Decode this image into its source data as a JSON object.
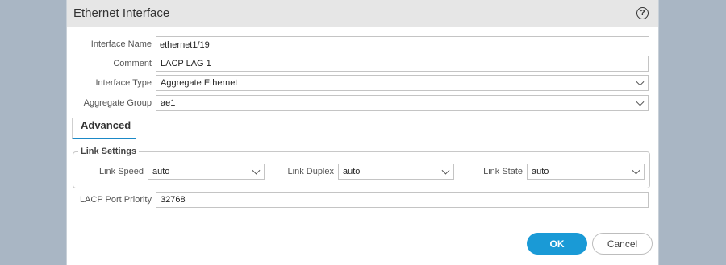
{
  "dialog": {
    "title": "Ethernet Interface",
    "help": "?"
  },
  "form": {
    "interface_name": {
      "label": "Interface Name",
      "value": "ethernet1/19"
    },
    "comment": {
      "label": "Comment",
      "value": "LACP LAG 1"
    },
    "interface_type": {
      "label": "Interface Type",
      "value": "Aggregate Ethernet"
    },
    "aggregate_group": {
      "label": "Aggregate Group",
      "value": "ae1"
    }
  },
  "tabs": [
    {
      "label": "Advanced"
    }
  ],
  "link_settings": {
    "legend": "Link Settings",
    "speed": {
      "label": "Link Speed",
      "value": "auto"
    },
    "duplex": {
      "label": "Link Duplex",
      "value": "auto"
    },
    "state": {
      "label": "Link State",
      "value": "auto"
    }
  },
  "lacp": {
    "label": "LACP Port Priority",
    "value": "32768"
  },
  "buttons": {
    "ok": "OK",
    "cancel": "Cancel"
  },
  "colors": {
    "accent": "#1a9ad6",
    "background": "#a9b6c4"
  }
}
